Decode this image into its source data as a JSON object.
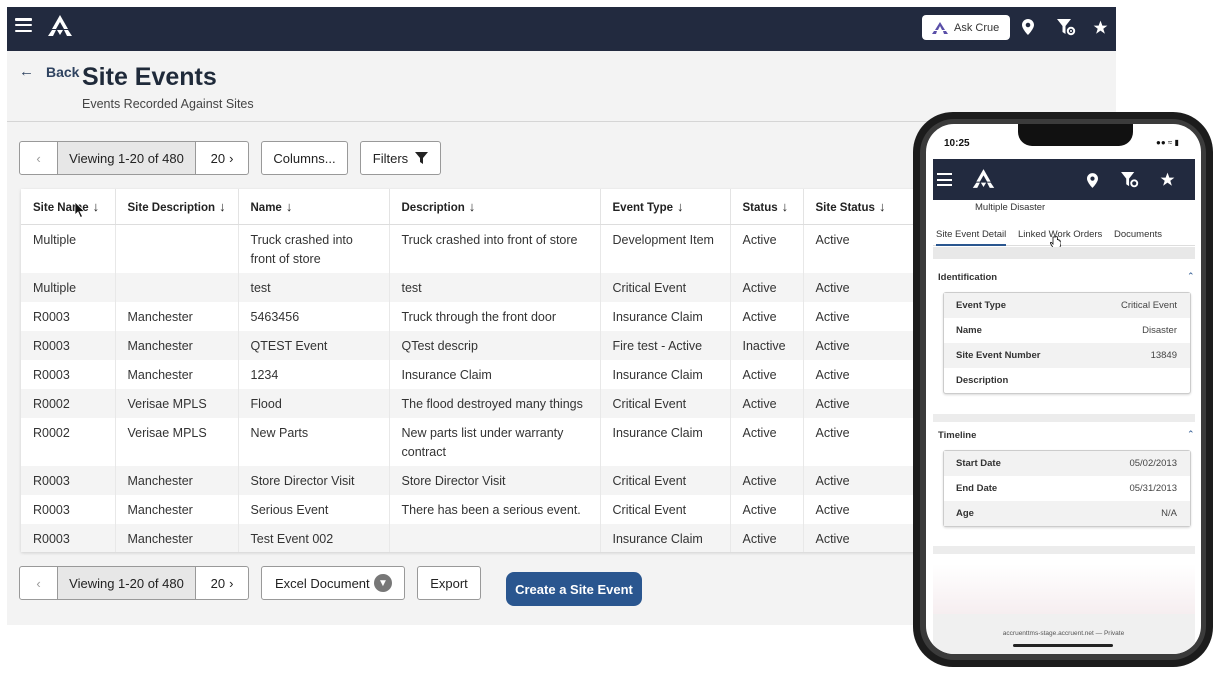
{
  "topbar": {
    "ask_label": "Ask Crue",
    "colors": {
      "bar": "#222a3f",
      "accent": "#2a568f"
    },
    "icons": [
      "menu-icon",
      "location-pin-icon",
      "filter-gear-icon",
      "star-icon"
    ]
  },
  "header": {
    "back_label": "Back",
    "title": "Site Events",
    "subtitle": "Events Recorded Against Sites"
  },
  "pager_top": {
    "viewing": "Viewing 1-20 of 480",
    "page_size": "20"
  },
  "toolbar": {
    "columns_label": "Columns...",
    "filters_label": "Filters"
  },
  "grid": {
    "columns": [
      "Site Name",
      "Site Description",
      "Name",
      "Description",
      "Event Type",
      "Status",
      "Site Status"
    ],
    "rows": [
      [
        "Multiple",
        "",
        "Truck crashed into front of store",
        "Truck crashed into front of store",
        "Development Item",
        "Active",
        "Active"
      ],
      [
        "Multiple",
        "",
        "test",
        "test",
        "Critical Event",
        "Active",
        "Active"
      ],
      [
        "R0003",
        "Manchester",
        "5463456",
        "Truck through the front door",
        "Insurance Claim",
        "Active",
        "Active"
      ],
      [
        "R0003",
        "Manchester",
        "QTEST Event",
        "QTest descrip",
        "Fire test - Active",
        "Inactive",
        "Active"
      ],
      [
        "R0003",
        "Manchester",
        "1234",
        "Insurance Claim",
        "Insurance Claim",
        "Active",
        "Active"
      ],
      [
        "R0002",
        "Verisae MPLS",
        "Flood",
        "The flood destroyed many things",
        "Critical Event",
        "Active",
        "Active"
      ],
      [
        "R0002",
        "Verisae MPLS",
        "New Parts",
        "New parts list under warranty contract",
        "Insurance Claim",
        "Active",
        "Active"
      ],
      [
        "R0003",
        "Manchester",
        "Store Director Visit",
        "Store Director Visit",
        "Critical Event",
        "Active",
        "Active"
      ],
      [
        "R0003",
        "Manchester",
        "Serious Event",
        "There has been a serious event.",
        "Critical Event",
        "Active",
        "Active"
      ],
      [
        "R0003",
        "Manchester",
        "Test Event 002",
        "",
        "Insurance Claim",
        "Active",
        "Active"
      ]
    ]
  },
  "pager_bottom": {
    "viewing": "Viewing 1-20 of 480",
    "page_size": "20"
  },
  "footer": {
    "export_format": "Excel Document",
    "export_label": "Export",
    "create_label": "Create a Site Event"
  },
  "mobile": {
    "time": "10:25",
    "event_title": "Multiple Disaster",
    "tabs": [
      "Site Event Detail",
      "Linked Work Orders",
      "Documents"
    ],
    "identification": {
      "title": "Identification",
      "fields": [
        {
          "k": "Event Type",
          "v": "Critical Event"
        },
        {
          "k": "Name",
          "v": "Disaster"
        },
        {
          "k": "Site Event Number",
          "v": "13849"
        },
        {
          "k": "Description",
          "v": ""
        }
      ]
    },
    "timeline": {
      "title": "Timeline",
      "fields": [
        {
          "k": "Start Date",
          "v": "05/02/2013"
        },
        {
          "k": "End Date",
          "v": "05/31/2013"
        },
        {
          "k": "Age",
          "v": "N/A"
        }
      ]
    },
    "url": "accruenttms-stage.accruent.net — Private"
  }
}
